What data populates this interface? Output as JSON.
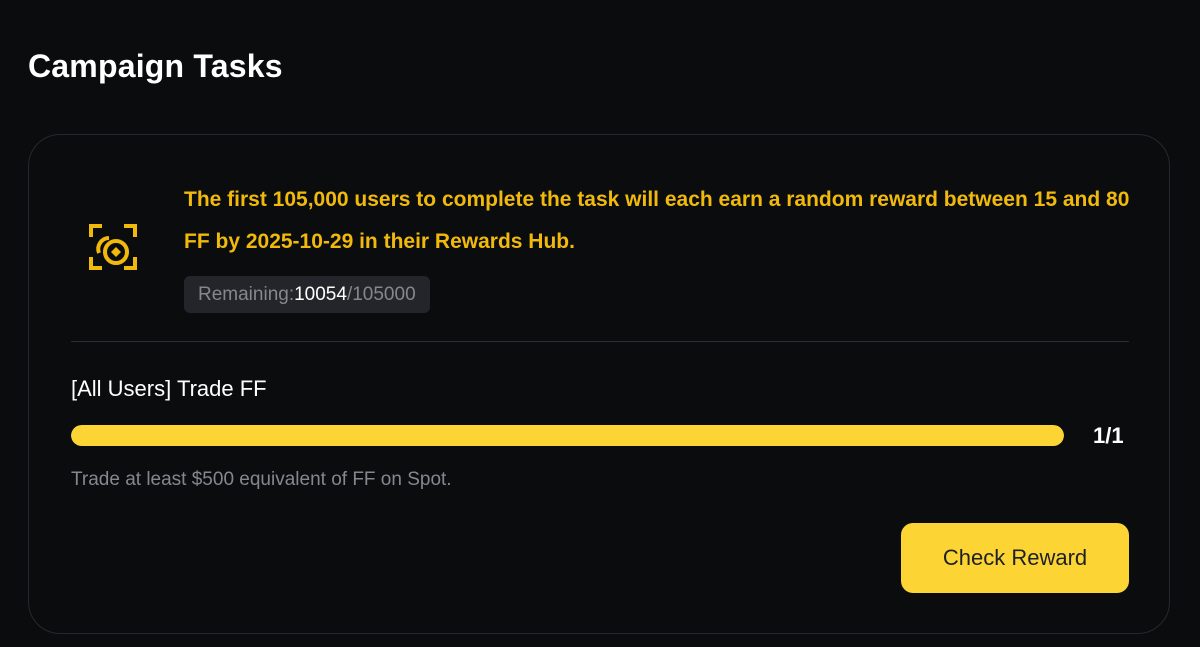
{
  "header": {
    "title": "Campaign Tasks"
  },
  "reward": {
    "icon": "reward-scan-icon",
    "description": "The first 105,000 users to complete the task will each earn a random reward between 15 and 80 FF by 2025-10-29 in their Rewards Hub.",
    "remaining_label": "Remaining: ",
    "remaining_count": "10054",
    "remaining_total": "/105000"
  },
  "task": {
    "title": "[All Users] Trade FF",
    "progress_fraction": 1,
    "progress_text": "1/1",
    "description": "Trade at least $500 equivalent of FF on Spot.",
    "button_label": "Check Reward"
  },
  "colors": {
    "accent": "#fcd535",
    "highlight_text": "#f0b90b",
    "background": "#0b0c0e",
    "muted_text": "#84888e"
  }
}
